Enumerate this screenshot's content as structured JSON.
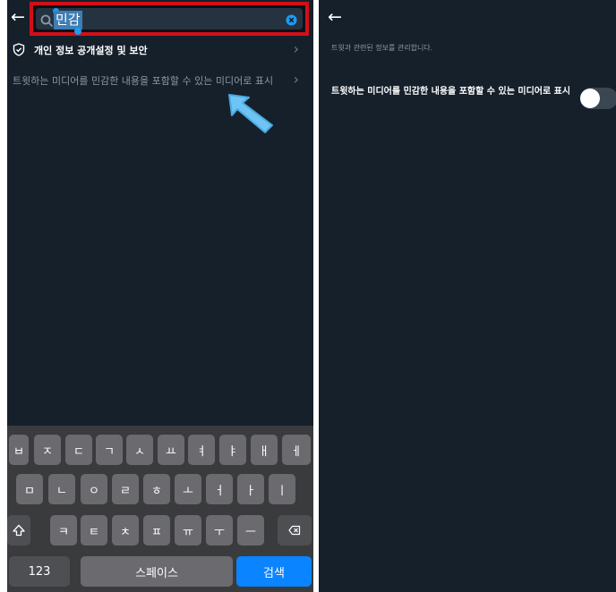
{
  "left_screen": {
    "search": {
      "query": "민감"
    },
    "results": [
      {
        "label": "개인 정보 공개설정 및 보안"
      },
      {
        "label": "트윗하는 미디어를 민감한 내용을 포함할 수 있는 미디어로 표시"
      }
    ],
    "keyboard": {
      "row1": [
        "ㅂ",
        "ㅈ",
        "ㄷ",
        "ㄱ",
        "ㅅ",
        "ㅛ",
        "ㅕ",
        "ㅑ",
        "ㅐ",
        "ㅔ"
      ],
      "row2": [
        "ㅁ",
        "ㄴ",
        "ㅇ",
        "ㄹ",
        "ㅎ",
        "ㅗ",
        "ㅓ",
        "ㅏ",
        "ㅣ"
      ],
      "row3": [
        "ㅋ",
        "ㅌ",
        "ㅊ",
        "ㅍ",
        "ㅠ",
        "ㅜ",
        "ㅡ"
      ],
      "numbers_label": "123",
      "space_label": "스페이스",
      "search_label": "검색"
    },
    "accent_color": "#1d9bf0",
    "highlight_border_color": "#d20f19"
  },
  "right_screen": {
    "description": "트윗과 관련된 정보를 관리합니다.",
    "setting_label": "트윗하는 미디어를 민감한 내용을 포함할 수 있는 미디어로 표시",
    "toggle_on": false
  }
}
